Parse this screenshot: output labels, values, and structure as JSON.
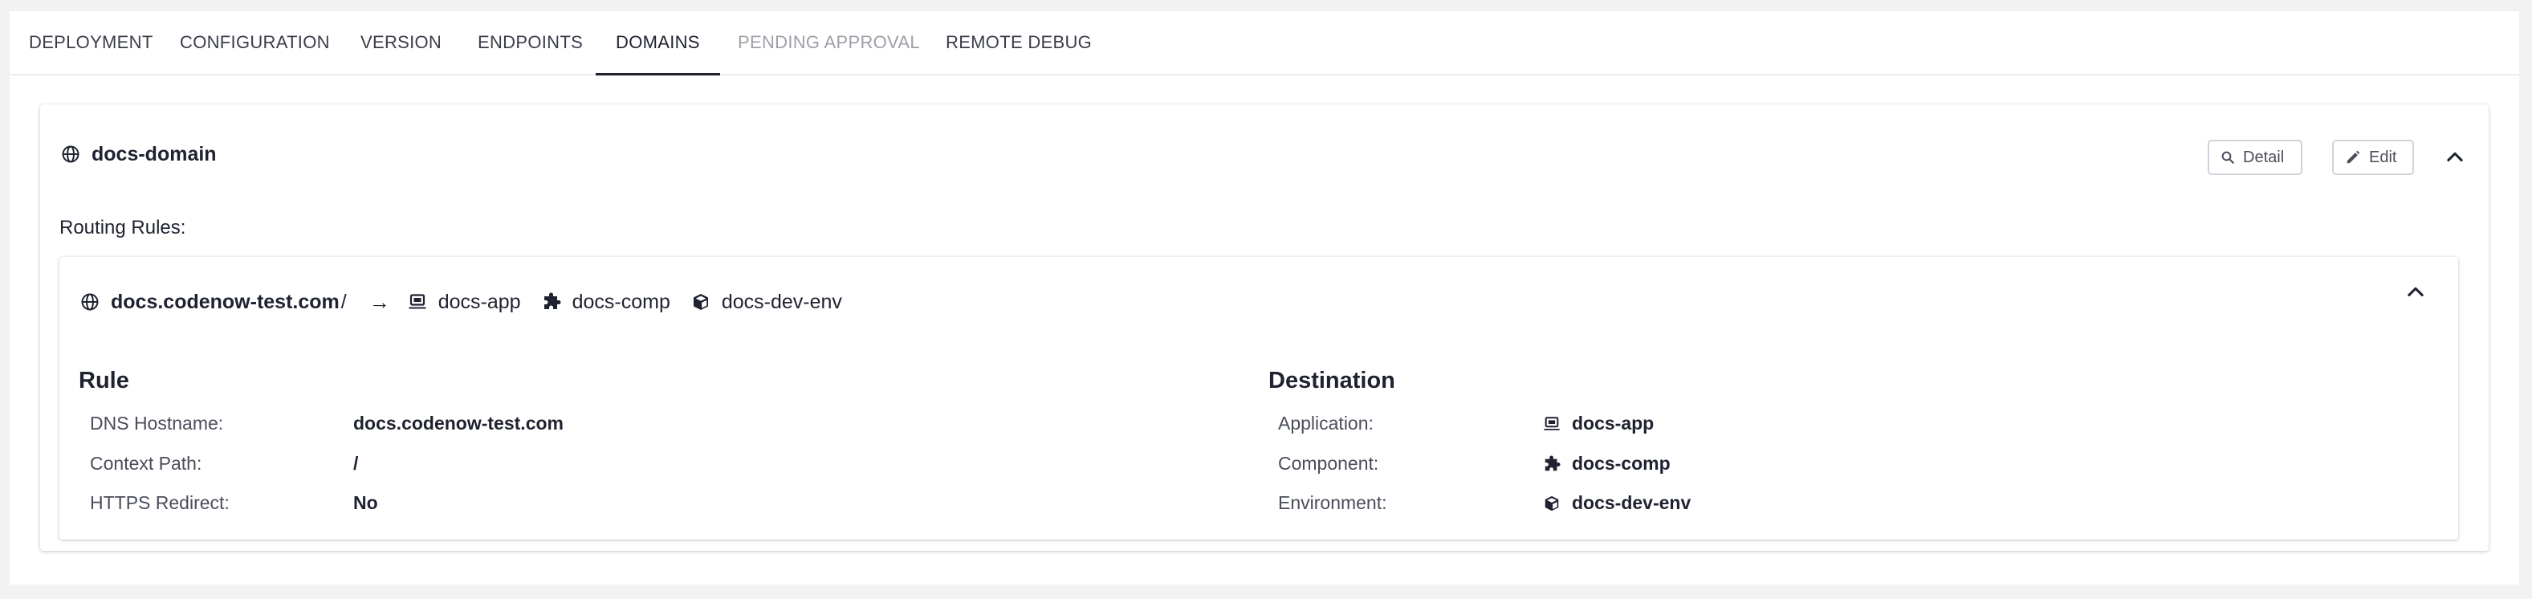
{
  "tabs": [
    {
      "label": "DEPLOYMENT",
      "state": "normal"
    },
    {
      "label": "CONFIGURATION",
      "state": "normal"
    },
    {
      "label": "VERSION",
      "state": "normal"
    },
    {
      "label": "ENDPOINTS",
      "state": "normal"
    },
    {
      "label": "DOMAINS",
      "state": "active"
    },
    {
      "label": "PENDING APPROVAL",
      "state": "disabled"
    },
    {
      "label": "REMOTE DEBUG",
      "state": "normal"
    }
  ],
  "domain": {
    "name": "docs-domain",
    "detail_label": "Detail",
    "edit_label": "Edit",
    "routing_rules_label": "Routing Rules:"
  },
  "rule": {
    "summary": {
      "host": "docs.codenow-test.com",
      "path": "/",
      "arrow": "→",
      "application": "docs-app",
      "component": "docs-comp",
      "environment": "docs-dev-env"
    },
    "rule_section": {
      "title": "Rule",
      "dns_label": "DNS Hostname:",
      "dns_value": "docs.codenow-test.com",
      "context_label": "Context Path:",
      "context_value": "/",
      "https_label": "HTTPS Redirect:",
      "https_value": "No"
    },
    "destination_section": {
      "title": "Destination",
      "application_label": "Application:",
      "application_value": "docs-app",
      "component_label": "Component:",
      "component_value": "docs-comp",
      "environment_label": "Environment:",
      "environment_value": "docs-dev-env"
    }
  },
  "icons": {
    "globe": "globe-icon",
    "search": "search-icon",
    "pencil": "pencil-icon",
    "chevron_up": "chevron-up-icon",
    "laptop": "laptop-icon",
    "puzzle": "puzzle-icon",
    "cube": "cube-icon"
  },
  "colors": {
    "text": "#1f2230",
    "muted": "#4a4d5a",
    "disabled": "#9da0a8",
    "background": "#f2f2f2"
  }
}
